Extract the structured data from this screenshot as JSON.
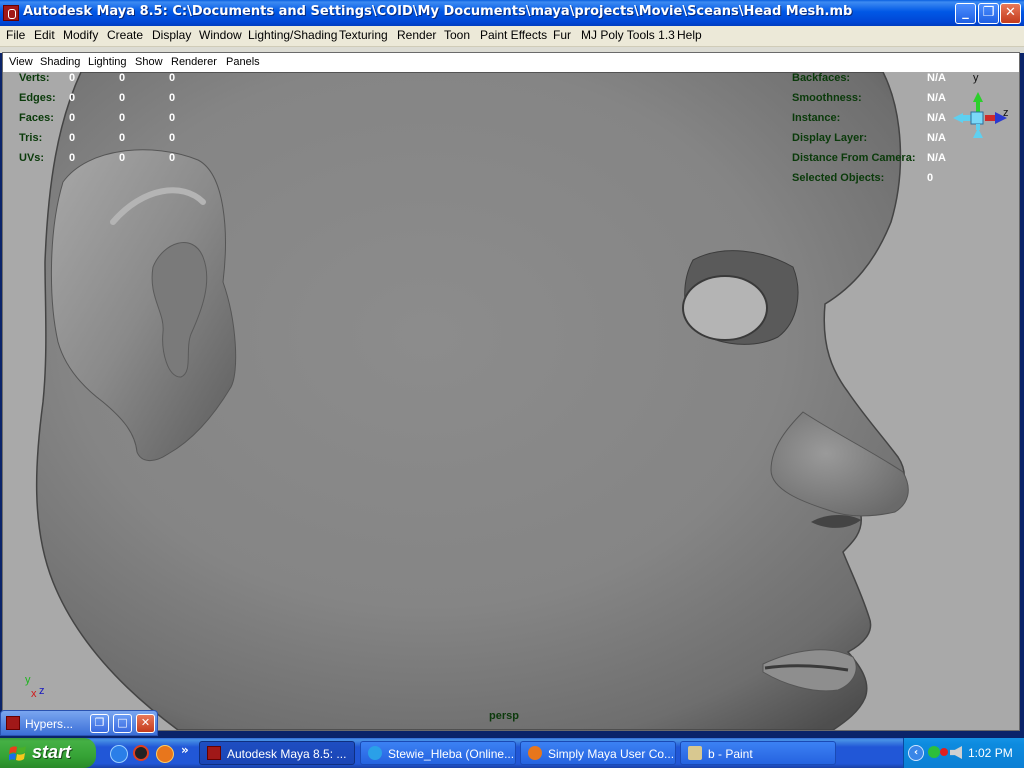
{
  "window": {
    "title": "Autodesk Maya 8.5: C:\\Documents and Settings\\COID\\My Documents\\maya\\projects\\Movie\\Sceans\\Head Mesh.mb",
    "minimize": "_",
    "restore": "❐",
    "close": "✕"
  },
  "menubar": [
    "File",
    "Edit",
    "Modify",
    "Create",
    "Display",
    "Window",
    "Lighting/Shading",
    "Texturing",
    "Render",
    "Toon",
    "Paint Effects",
    "Fur",
    "MJ Poly Tools 1.3",
    "Help"
  ],
  "panel_menu": [
    "View",
    "Shading",
    "Lighting",
    "Show",
    "Renderer",
    "Panels"
  ],
  "hud_left": [
    {
      "label": "Verts:",
      "v1": "0",
      "v2": "0",
      "v3": "0"
    },
    {
      "label": "Edges:",
      "v1": "0",
      "v2": "0",
      "v3": "0"
    },
    {
      "label": "Faces:",
      "v1": "0",
      "v2": "0",
      "v3": "0"
    },
    {
      "label": "Tris:",
      "v1": "0",
      "v2": "0",
      "v3": "0"
    },
    {
      "label": "UVs:",
      "v1": "0",
      "v2": "0",
      "v3": "0"
    }
  ],
  "hud_right": [
    {
      "label": "Backfaces:",
      "value": "N/A"
    },
    {
      "label": "Smoothness:",
      "value": "N/A"
    },
    {
      "label": "Instance:",
      "value": "N/A"
    },
    {
      "label": "Display Layer:",
      "value": "N/A"
    },
    {
      "label": "Distance From Camera:",
      "value": "N/A"
    },
    {
      "label": "Selected Objects:",
      "value": "0"
    }
  ],
  "view_cube": {
    "y": "y",
    "z": "z"
  },
  "axis": {
    "y": "y",
    "x": "x",
    "z": "z"
  },
  "camera": "persp",
  "hypershade": {
    "title": "Hypers...",
    "restore": "❐",
    "maximize": "□",
    "close": "✕"
  },
  "taskbar": {
    "start": "start",
    "quick_launch_more": "»",
    "tasks": [
      {
        "label": "Autodesk Maya 8.5: ...",
        "icon": "maya-icon",
        "active": true
      },
      {
        "label": "Stewie_Hleba (Online...",
        "icon": "messenger-icon",
        "active": false
      },
      {
        "label": "Simply Maya User Co...",
        "icon": "firefox-icon",
        "active": false
      },
      {
        "label": "b - Paint",
        "icon": "paint-icon",
        "active": false
      }
    ],
    "tray_expand": "‹",
    "clock": "1:02 PM"
  },
  "colors": {
    "viewport_bg": "#a9a9a9",
    "hud_text": "#0a3a0a",
    "xp_blue": "#0058e6",
    "start_green": "#36a336"
  }
}
